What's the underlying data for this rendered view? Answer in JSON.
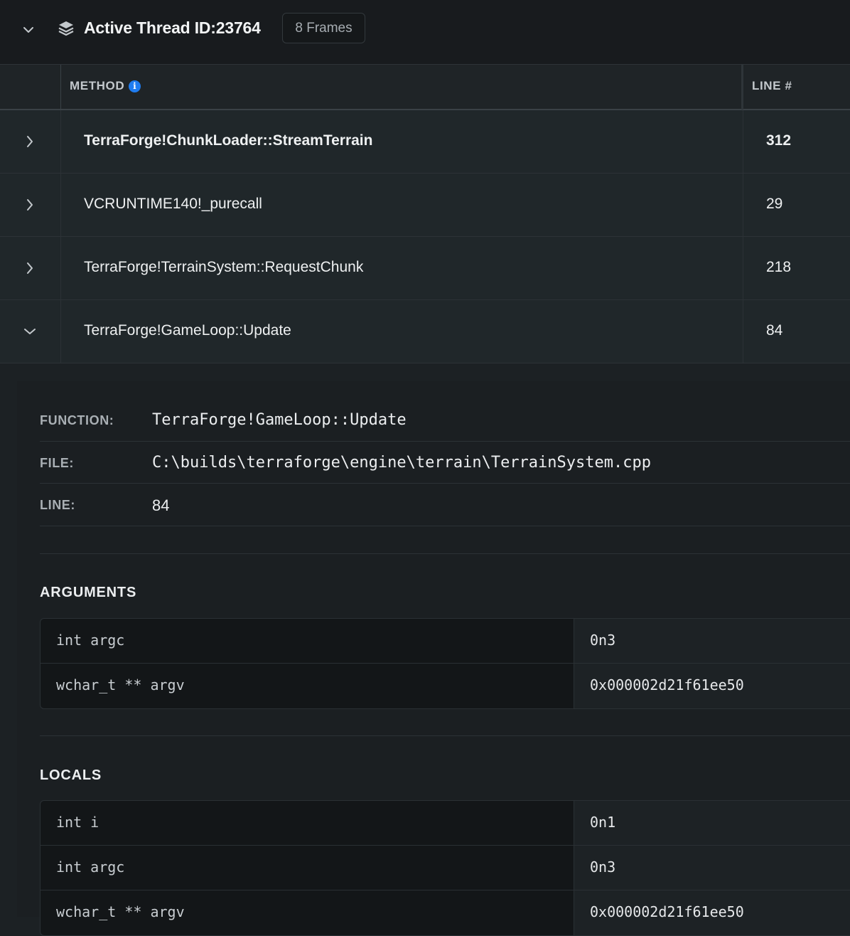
{
  "header": {
    "title": "Active Thread ID:23764",
    "frames_badge": "8 Frames"
  },
  "table": {
    "columns": {
      "method": "METHOD",
      "line": "LINE #"
    },
    "rows": [
      {
        "method": "TerraForge!ChunkLoader::StreamTerrain",
        "line": "312",
        "expanded": false
      },
      {
        "method": "VCRUNTIME140!_purecall",
        "line": "29",
        "expanded": false
      },
      {
        "method": "TerraForge!TerrainSystem::RequestChunk",
        "line": "218",
        "expanded": false
      },
      {
        "method": "TerraForge!GameLoop::Update",
        "line": "84",
        "expanded": true
      }
    ]
  },
  "details": {
    "function_label": "FUNCTION:",
    "function_value": "TerraForge!GameLoop::Update",
    "file_label": "FILE:",
    "file_value": "C:\\builds\\terraforge\\engine\\terrain\\TerrainSystem.cpp",
    "line_label": "LINE:",
    "line_value": "84",
    "arguments_title": "ARGUMENTS",
    "arguments": [
      {
        "name": "int argc",
        "value": "0n3"
      },
      {
        "name": "wchar_t ** argv",
        "value": "0x000002d21f61ee50"
      }
    ],
    "locals_title": "LOCALS",
    "locals": [
      {
        "name": "int i",
        "value": "0n1"
      },
      {
        "name": "int argc",
        "value": "0n3"
      },
      {
        "name": "wchar_t ** argv",
        "value": "0x000002d21f61ee50"
      }
    ]
  },
  "colors": {
    "background": "#1c2124",
    "header_bg": "#181b1e",
    "info_accent": "#1f7cf0"
  }
}
